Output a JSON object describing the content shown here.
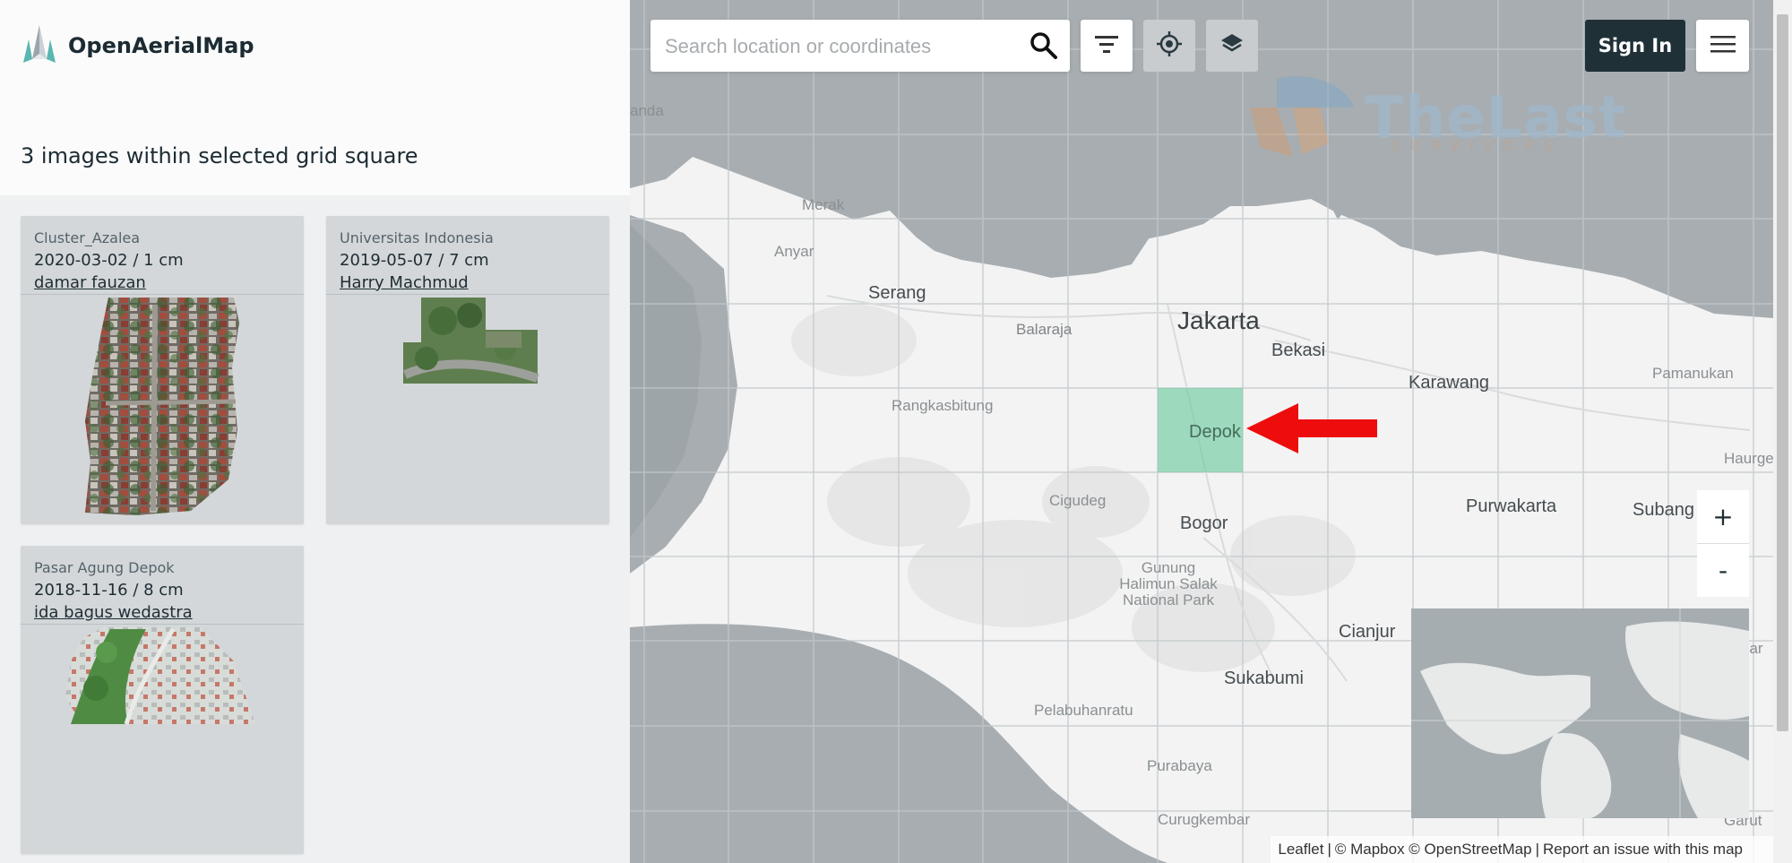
{
  "app": {
    "name": "OpenAerialMap"
  },
  "panel": {
    "results_title": "3 images within selected grid square",
    "cards": [
      {
        "name": "Cluster_Azalea",
        "date_res": "2020-03-02 / 1 cm",
        "user": "damar fauzan"
      },
      {
        "name": "Universitas Indonesia",
        "date_res": "2019-05-07 / 7 cm",
        "user": "Harry Machmud"
      },
      {
        "name": "Pasar Agung Depok",
        "date_res": "2018-11-16 / 8 cm",
        "user": "ida bagus wedastra"
      }
    ]
  },
  "toolbar": {
    "search_placeholder": "Search location or coordinates",
    "sign_in": "Sign In"
  },
  "map": {
    "zoom_in": "+",
    "zoom_out": "-",
    "selected_cell_label": "Depok",
    "places": {
      "jakarta": "Jakarta",
      "bekasi": "Bekasi",
      "serang": "Serang",
      "balaraja": "Balaraja",
      "rangkasbitung": "Rangkasbitung",
      "karawang": "Karawang",
      "purwakarta": "Purwakarta",
      "subang": "Subang",
      "bogor": "Bogor",
      "cigudeg": "Cigudeg",
      "cianjur": "Cianjur",
      "sukabumi": "Sukabumi",
      "pelabuhanratu": "Pelabuhanratu",
      "purabaya": "Purabaya",
      "curugkembar": "Curugkembar",
      "merak": "Merak",
      "anyar": "Anyar",
      "pamanukan": "Pamanukan",
      "haurgeulis": "Haurge",
      "garut": "Garut",
      "landa": "anda",
      "dar": "dar",
      "gunung1": "Gunung",
      "gunung2": "Halimun Salak",
      "gunung3": "National Park"
    },
    "watermark": {
      "title": "TheLast",
      "subtitle": "SURVIVORS"
    },
    "attribution": {
      "leaflet": "Leaflet",
      "sep1": "|",
      "copy": "© Mapbox © OpenStreetMap",
      "sep2": "|",
      "report": "Report an issue with this map"
    }
  },
  "colors": {
    "accent": "#1f3037",
    "selected_cell": "#6ecca0",
    "water": "#a7adb1",
    "land": "#f3f3f3"
  }
}
